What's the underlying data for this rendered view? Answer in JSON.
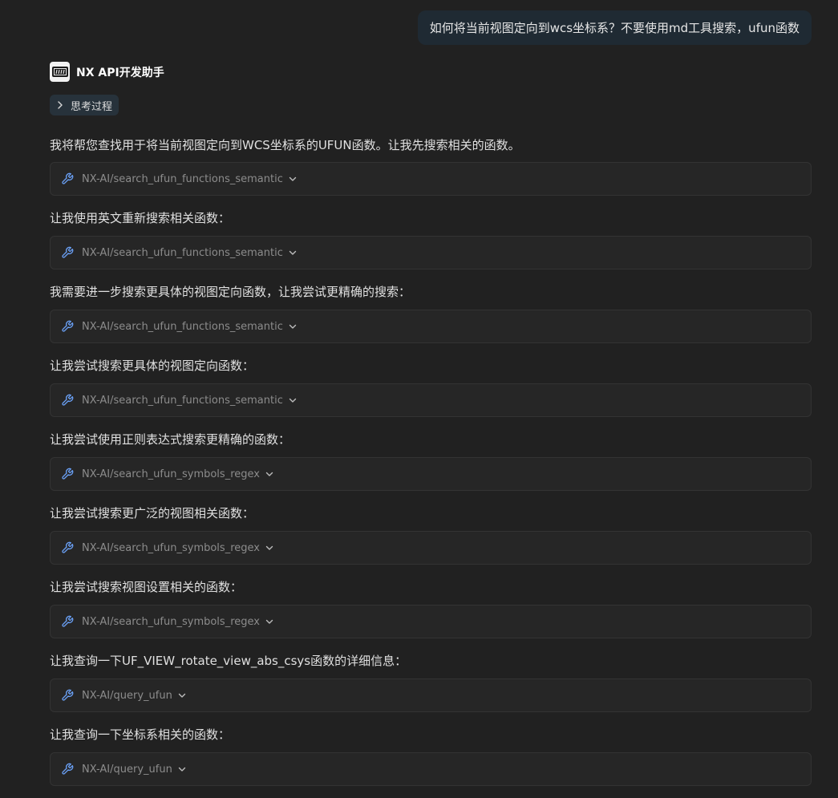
{
  "user_message": "如何将当前视图定向到wcs坐标系？不要使用md工具搜索，ufun函数",
  "assistant": {
    "name": "NX API开发助手",
    "thinking_label": "思考过程"
  },
  "steps": [
    {
      "text": "我将帮您查找用于将当前视图定向到WCS坐标系的UFUN函数。让我先搜索相关的函数。",
      "tool": "NX-AI/search_ufun_functions_semantic"
    },
    {
      "text": "让我使用英文重新搜索相关函数：",
      "tool": "NX-AI/search_ufun_functions_semantic"
    },
    {
      "text": "我需要进一步搜索更具体的视图定向函数，让我尝试更精确的搜索：",
      "tool": "NX-AI/search_ufun_functions_semantic"
    },
    {
      "text": "让我尝试搜索更具体的视图定向函数：",
      "tool": "NX-AI/search_ufun_functions_semantic"
    },
    {
      "text": "让我尝试使用正则表达式搜索更精确的函数：",
      "tool": "NX-AI/search_ufun_symbols_regex"
    },
    {
      "text": "让我尝试搜索更广泛的视图相关函数：",
      "tool": "NX-AI/search_ufun_symbols_regex"
    },
    {
      "text": "让我尝试搜索视图设置相关的函数：",
      "tool": "NX-AI/search_ufun_symbols_regex"
    },
    {
      "text": "让我查询一下UF_VIEW_rotate_view_abs_csys函数的详细信息：",
      "tool": "NX-AI/query_ufun"
    },
    {
      "text": "让我查询一下坐标系相关的函数：",
      "tool": "NX-AI/query_ufun"
    }
  ],
  "colors": {
    "background": "#212121",
    "user_bubble": "#1f2a33",
    "tool_card": "#262626",
    "tool_icon": "#6aa0f5",
    "tool_text": "#8c8c8c"
  }
}
